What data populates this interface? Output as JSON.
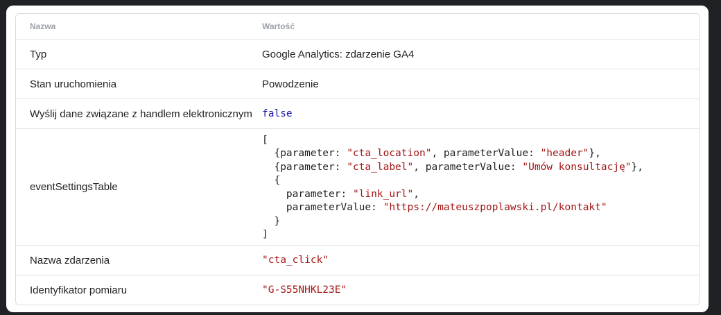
{
  "table": {
    "header": {
      "name": "Nazwa",
      "value": "Wartość"
    },
    "rows": [
      {
        "name": "Typ",
        "value": "Google Analytics: zdarzenie GA4"
      },
      {
        "name": "Stan uruchomienia",
        "value": "Powodzenie"
      },
      {
        "name": "Wyślij dane związane z handlem elektronicznym",
        "value": "false"
      },
      {
        "name": "eventSettingsTable",
        "code": {
          "open": "[",
          "close": "]",
          "entries": [
            {
              "parameter": "\"cta_location\"",
              "parameterValue": "\"header\""
            },
            {
              "parameter": "\"cta_label\"",
              "parameterValue": "\"Umów konsultację\""
            },
            {
              "parameter": "\"link_url\"",
              "parameterValue": "\"https://mateuszpoplawski.pl/kontakt\""
            }
          ]
        }
      },
      {
        "name": "Nazwa zdarzenia",
        "value": "\"cta_click\""
      },
      {
        "name": "Identyfikator pomiaru",
        "value": "\"G-S55NHKL23E\""
      }
    ]
  }
}
